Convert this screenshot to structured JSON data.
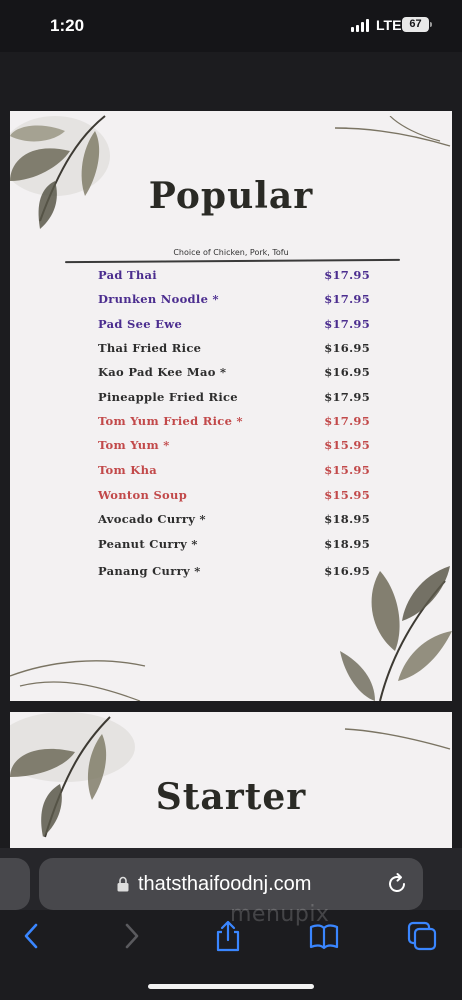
{
  "status": {
    "time": "1:20",
    "network": "LTE",
    "battery": "67"
  },
  "menu": {
    "section_title": "Popular",
    "subtitle": "Choice of Chicken, Pork, Tofu",
    "items": [
      {
        "name": "Pad Thai",
        "price": "$17.95",
        "color": "#4b2d8f"
      },
      {
        "name": "Drunken Noodle *",
        "price": "$17.95",
        "color": "#4b2d8f"
      },
      {
        "name": "Pad See Ewe",
        "price": "$17.95",
        "color": "#4b2d8f"
      },
      {
        "name": "Thai Fried Rice",
        "price": "$16.95",
        "color": "#2d2d2d"
      },
      {
        "name": "Kao Pad Kee Mao *",
        "price": "$16.95",
        "color": "#2d2d2d"
      },
      {
        "name": "Pineapple Fried Rice",
        "price": "$17.95",
        "color": "#2d2d2d"
      },
      {
        "name": "Tom Yum Fried Rice *",
        "price": "$17.95",
        "color": "#c2494a"
      },
      {
        "name": "Tom Yum *",
        "price": "$15.95",
        "color": "#c2494a"
      },
      {
        "name": "Tom Kha",
        "price": "$15.95",
        "color": "#c2494a"
      },
      {
        "name": "Wonton Soup",
        "price": "$15.95",
        "color": "#c2494a"
      },
      {
        "name": "Avocado Curry *",
        "price": "$18.95",
        "color": "#2d2d2d"
      },
      {
        "name": "Peanut Curry *",
        "price": "$18.95",
        "color": "#2d2d2d"
      },
      {
        "name": "Panang Curry *",
        "price": "$16.95",
        "color": "#2d2d2d"
      }
    ],
    "next_section_title": "Starter"
  },
  "browser": {
    "url": "thatsthaifoodnj.com",
    "watermark": "menupix",
    "icons": [
      "back-icon",
      "forward-icon",
      "share-icon",
      "bookmarks-icon",
      "tabs-icon"
    ]
  }
}
